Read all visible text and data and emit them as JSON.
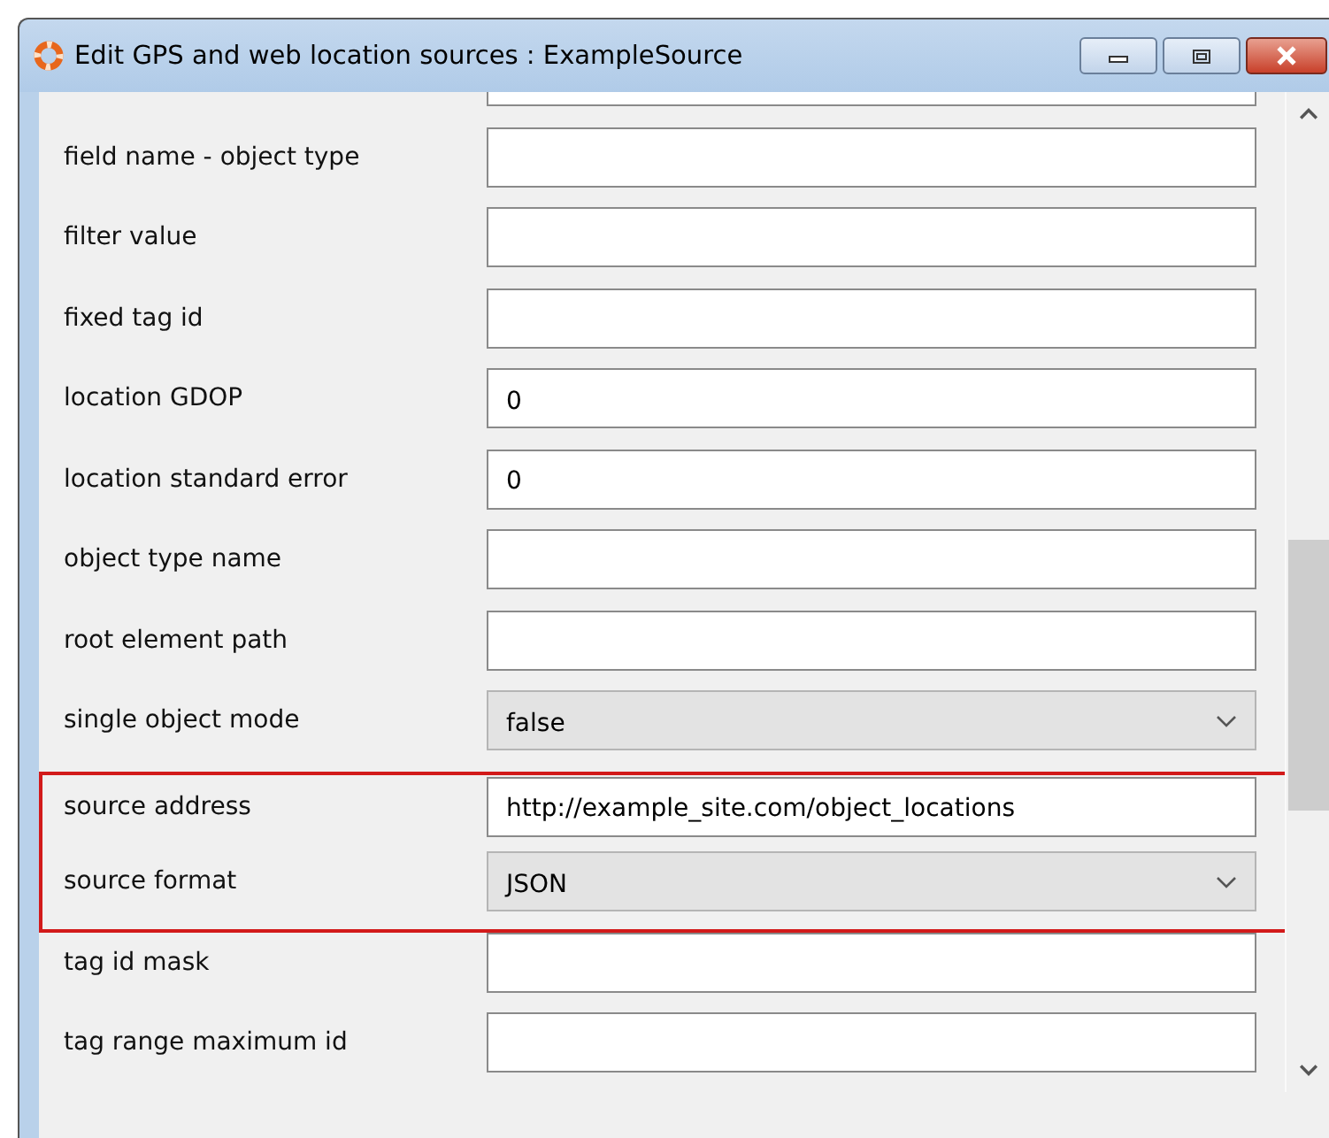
{
  "window": {
    "title": "Edit GPS and web location sources : ExampleSource"
  },
  "rows": [
    {
      "kind": "input",
      "highlighted": false
    },
    {
      "kind": "input",
      "label": "field name - object type",
      "highlighted": false
    },
    {
      "kind": "input",
      "label": "filter value",
      "highlighted": false
    },
    {
      "kind": "input",
      "label": "fixed tag id",
      "highlighted": false
    },
    {
      "kind": "input",
      "label": "location GDOP",
      "value": "0",
      "highlighted": false
    },
    {
      "kind": "input",
      "label": "location standard error",
      "value": "0",
      "highlighted": false
    },
    {
      "kind": "input",
      "label": "object type name",
      "highlighted": false
    },
    {
      "kind": "input",
      "label": "root element path",
      "highlighted": false
    },
    {
      "kind": "select",
      "label": "single object mode",
      "value": "false",
      "highlighted": false
    },
    {
      "kind": "input",
      "label": "source address",
      "value": "http://example_site.com/object_locations",
      "highlighted": true
    },
    {
      "kind": "select",
      "label": "source format",
      "value": "JSON",
      "highlighted": true
    },
    {
      "kind": "input",
      "label": "tag id mask",
      "highlighted": false
    },
    {
      "kind": "input",
      "label": "tag range maximum id",
      "highlighted": false
    }
  ]
}
